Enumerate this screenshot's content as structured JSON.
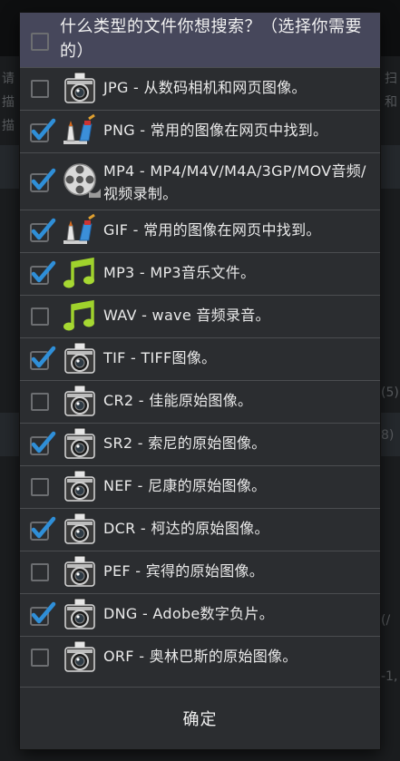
{
  "dialog": {
    "title": "什么类型的文件你想搜索？（选择你需要的）",
    "confirm_label": "确定",
    "items": [
      {
        "label": "JPG - 从数码相机和网页图像。",
        "checked": false,
        "icon": "camera-icon"
      },
      {
        "label": "PNG - 常用的图像在网页中找到。",
        "checked": true,
        "icon": "paint-brush-icon"
      },
      {
        "label": "MP4 - MP4/M4V/M4A/3GP/MOV音频/视频录制。",
        "checked": true,
        "icon": "film-reel-icon"
      },
      {
        "label": "GIF - 常用的图像在网页中找到。",
        "checked": true,
        "icon": "paint-brush-icon"
      },
      {
        "label": "MP3 - MP3音乐文件。",
        "checked": true,
        "icon": "music-note-icon"
      },
      {
        "label": "WAV - wave 音频录音。",
        "checked": false,
        "icon": "music-note-icon"
      },
      {
        "label": "TIF - TIFF图像。",
        "checked": true,
        "icon": "camera-icon"
      },
      {
        "label": "CR2 - 佳能原始图像。",
        "checked": false,
        "icon": "camera-icon"
      },
      {
        "label": "SR2 - 索尼的原始图像。",
        "checked": true,
        "icon": "camera-icon"
      },
      {
        "label": "NEF - 尼康的原始图像。",
        "checked": false,
        "icon": "camera-icon"
      },
      {
        "label": "DCR - 柯达的原始图像。",
        "checked": true,
        "icon": "camera-icon"
      },
      {
        "label": "PEF - 宾得的原始图像。",
        "checked": false,
        "icon": "camera-icon"
      },
      {
        "label": "DNG - Adobe数字负片。",
        "checked": true,
        "icon": "camera-icon"
      },
      {
        "label": "ORF - 奥林巴斯的原始图像。",
        "checked": false,
        "icon": "camera-icon"
      }
    ]
  },
  "background": {
    "left_fragments": [
      "请",
      "描",
      "描"
    ],
    "right_fragments": [
      "扫",
      "和",
      "(5)",
      "8)",
      "(/",
      "-1,"
    ]
  },
  "colors": {
    "header_bg": "#46475b",
    "dialog_bg": "#2b2d30",
    "check_blue": "#2f8fd8",
    "divider": "#4b4d50"
  }
}
